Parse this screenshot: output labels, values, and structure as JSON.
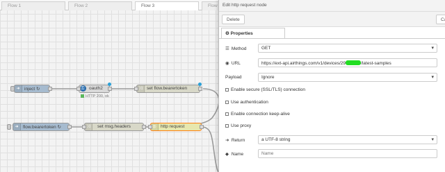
{
  "workspace": {
    "tabs": [
      {
        "label": "Flow 1"
      },
      {
        "label": "Flow 2"
      },
      {
        "label": "Flow 3"
      },
      {
        "label": "Flow"
      }
    ],
    "nodes": {
      "inject": {
        "label": "inject ↻"
      },
      "oauth2": {
        "label": "oauth2",
        "status": "HTTP 200, ok"
      },
      "set_flow_bearertoken": {
        "label": "set flow.bearertoken"
      },
      "flow_bearertoken": {
        "label": "flow.bearertoken ↻"
      },
      "set_msg_headers": {
        "label": "set msg.headers"
      },
      "http_request": {
        "label": "http request"
      }
    }
  },
  "editor": {
    "title": "Edit http request node",
    "delete_label": "Delete",
    "cancel_label": "Can",
    "properties_tab": "Properties",
    "method": {
      "label": "Method",
      "value": "GET"
    },
    "url": {
      "label": "URL",
      "value_prefix": "https://ext-api.airthings.com/v1/devices/29",
      "value_suffix": "/latest-samples"
    },
    "payload": {
      "label": "Payload",
      "value": "Ignore"
    },
    "ssl": {
      "label": "Enable secure (SSL/TLS) connection"
    },
    "auth": {
      "label": "Use authentication"
    },
    "keepalive": {
      "label": "Enable connection keep-alive"
    },
    "proxy": {
      "label": "Use proxy"
    },
    "return": {
      "label": "Return",
      "value": "a UTF-8 string"
    },
    "name": {
      "label": "Name",
      "placeholder": "Name"
    }
  },
  "colors": {
    "change_node": "#d8d8c8",
    "inject_node": "#a6bbcf",
    "http_node": "#e7e7ae",
    "oauth_node": "#d9d9d9",
    "changed_dot": "#29a0d8",
    "redaction": "#22dd22"
  }
}
